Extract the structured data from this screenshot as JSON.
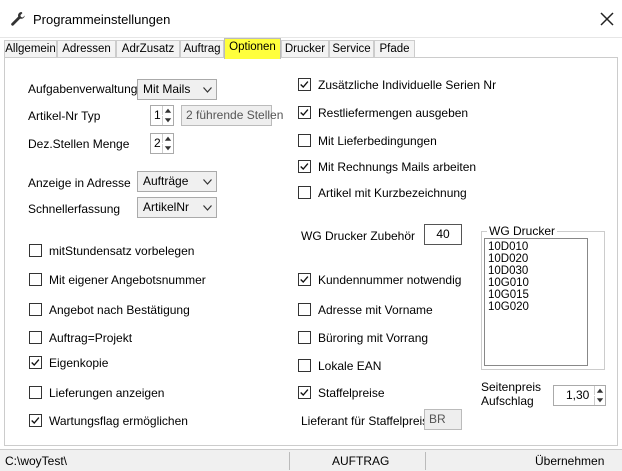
{
  "window": {
    "title": "Programmeinstellungen"
  },
  "tabs": [
    "Allgemein",
    "Adressen",
    "AdrZusatz",
    "Auftrag",
    "Optionen",
    "Drucker",
    "Service",
    "Pfade"
  ],
  "active_tab": "Optionen",
  "left": {
    "aufgabenverwaltung": {
      "label": "Aufgabenverwaltung",
      "value": "Mit Mails"
    },
    "artikel_nr_typ": {
      "label": "Artikel-Nr Typ",
      "value": "1",
      "hint": "2 führende Stellen"
    },
    "dez_stellen_menge": {
      "label": "Dez.Stellen Menge",
      "value": "2"
    },
    "anzeige_in_adresse": {
      "label": "Anzeige in Adresse",
      "value": "Aufträge"
    },
    "schnellerfassung": {
      "label": "Schnellerfassung",
      "value": "ArtikelNr"
    },
    "checkboxes": [
      {
        "label": "mitStundensatz vorbelegen",
        "checked": false
      },
      {
        "label": "Mit eigener Angebotsnummer",
        "checked": false
      },
      {
        "label": "Angebot nach Bestätigung",
        "checked": false
      },
      {
        "label": "Auftrag=Projekt",
        "checked": false
      },
      {
        "label": "Eigenkopie",
        "checked": true
      },
      {
        "label": "Lieferungen anzeigen",
        "checked": false
      },
      {
        "label": "Wartungsflag ermöglichen",
        "checked": true
      }
    ]
  },
  "right": {
    "checkboxes_top": [
      {
        "label": "Zusätzliche Individuelle Serien Nr",
        "checked": true
      },
      {
        "label": "Restliefermengen ausgeben",
        "checked": true
      },
      {
        "label": "Mit Lieferbedingungen",
        "checked": false
      },
      {
        "label": "Mit Rechnungs Mails arbeiten",
        "checked": true
      },
      {
        "label": "Artikel mit Kurzbezeichnung",
        "checked": false
      }
    ],
    "wg_zubehoer": {
      "label": "WG Drucker Zubehör",
      "value": "40"
    },
    "checkboxes_bottom": [
      {
        "label": "Kundennummer notwendig",
        "checked": true
      },
      {
        "label": "Adresse mit Vorname",
        "checked": false
      },
      {
        "label": "Büroring mit Vorrang",
        "checked": false
      },
      {
        "label": "Lokale EAN",
        "checked": false
      },
      {
        "label": "Staffelpreise",
        "checked": true
      }
    ],
    "lieferant_staffelpreis": {
      "label": "Lieferant für Staffelpreis",
      "value": "BR"
    },
    "wg_drucker": {
      "label": "WG Drucker",
      "items": [
        "10D010",
        "10D020",
        "10D030",
        "10G010",
        "10G015",
        "10G020"
      ]
    },
    "seitenpreis": {
      "label_line1": "Seitenpreis",
      "label_line2": "Aufschlag",
      "value": "1,30"
    }
  },
  "status": {
    "path": "C:\\woyTest\\",
    "mode": "AUFTRAG",
    "action": "Übernehmen"
  }
}
